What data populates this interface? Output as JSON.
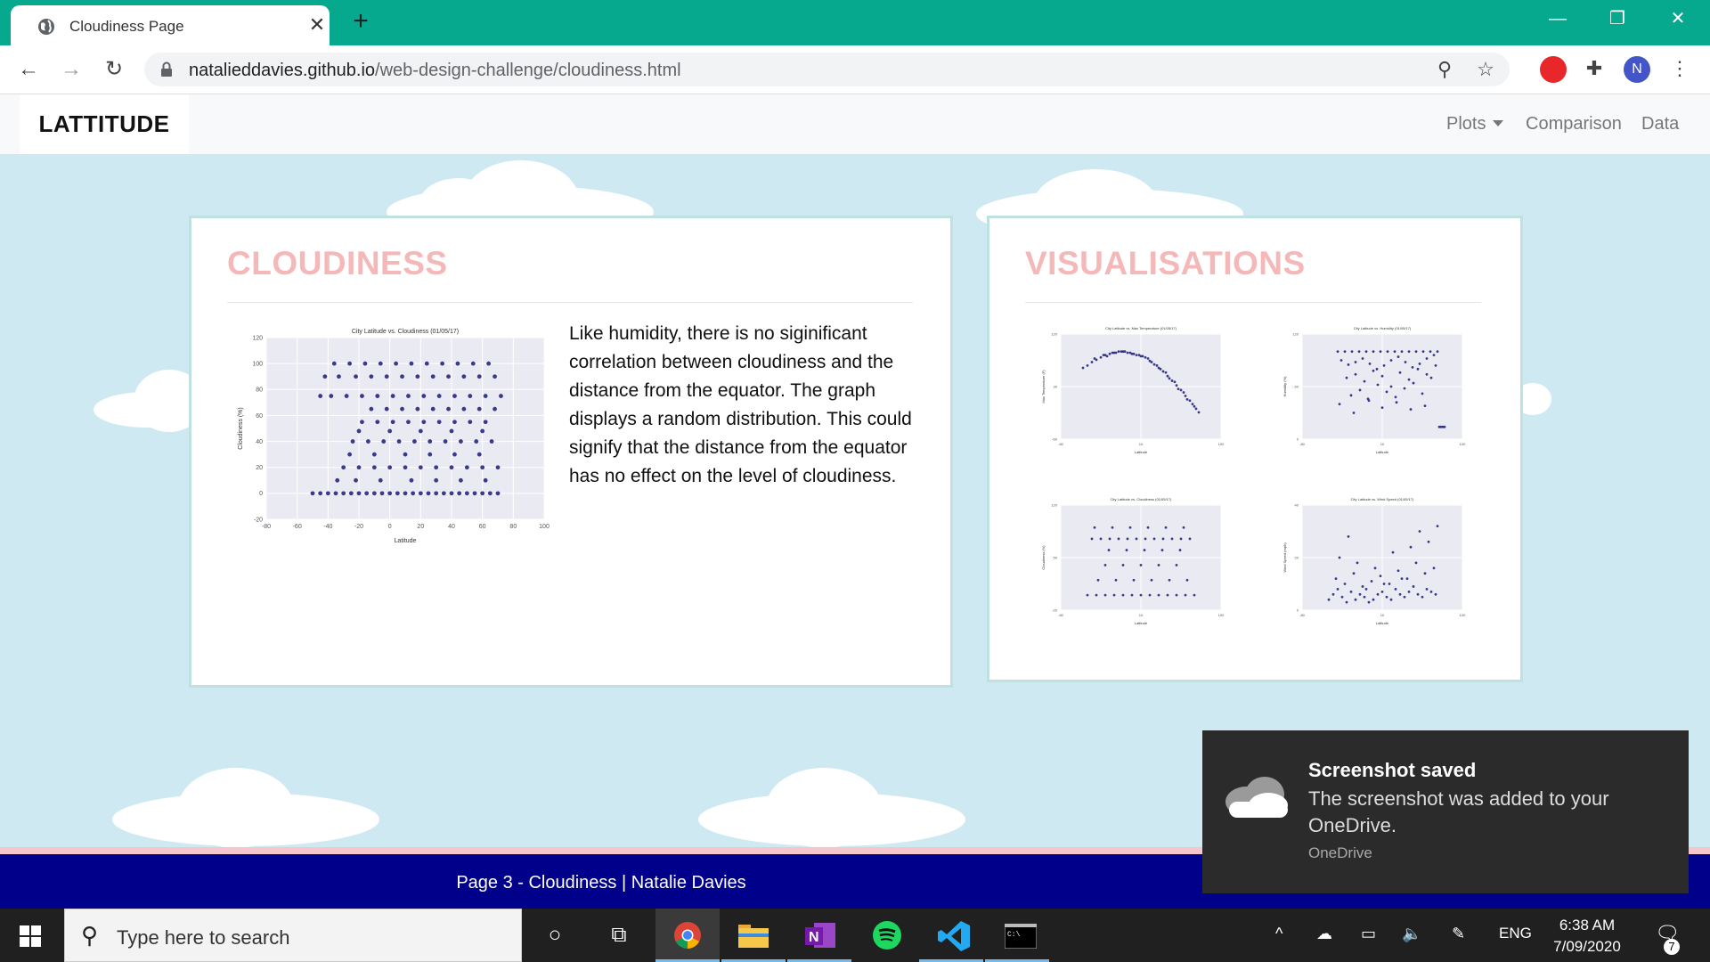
{
  "browser": {
    "tab_title": "Cloudiness Page",
    "url_host": "natalieddavies.github.io",
    "url_path": "/web-design-challenge/cloudiness.html",
    "profile_initial": "N"
  },
  "navbar": {
    "brand": "LATTITUDE",
    "links": [
      "Plots",
      "Comparison",
      "Data"
    ]
  },
  "main": {
    "title": "CLOUDINESS",
    "description": "Like humidity, there is no siginificant correlation between cloudiness and the distance from the equator. The graph displays a random distribution. This could signify that the distance from the equator has no effect on the level of cloudiness."
  },
  "sidebar": {
    "title": "VISUALISATIONS"
  },
  "footer": {
    "text": "Page 3 - Cloudiness | Natalie Davies"
  },
  "toast": {
    "title": "Screenshot saved",
    "body": "The screenshot was added to your OneDrive.",
    "source": "OneDrive"
  },
  "taskbar": {
    "search_placeholder": "Type here to search",
    "language": "ENG",
    "time": "6:38 AM",
    "date": "7/09/2020",
    "notification_count": "7"
  },
  "chart_data": [
    {
      "type": "scatter",
      "title": "City Latitude vs. Cloudiness (01/05/17)",
      "xlabel": "Latitude",
      "ylabel": "Cloudiness (%)",
      "xlim": [
        -80,
        100
      ],
      "ylim": [
        -20,
        120
      ],
      "xticks": [
        -80,
        -60,
        -40,
        -20,
        0,
        20,
        40,
        60,
        80,
        100
      ],
      "yticks": [
        -20,
        0,
        20,
        40,
        60,
        80,
        100,
        120
      ],
      "color": "#1a1a7a",
      "x": [
        -50,
        -45,
        -40,
        -35,
        -30,
        -25,
        -20,
        -15,
        -10,
        -5,
        0,
        5,
        10,
        15,
        20,
        25,
        30,
        35,
        40,
        45,
        50,
        55,
        60,
        65,
        70,
        -45,
        -38,
        -28,
        -18,
        -8,
        2,
        12,
        22,
        32,
        42,
        52,
        62,
        72,
        -42,
        -33,
        -22,
        -12,
        -2,
        8,
        18,
        28,
        38,
        48,
        58,
        68,
        -36,
        -26,
        -16,
        -6,
        4,
        14,
        24,
        34,
        44,
        54,
        64,
        -30,
        -20,
        -10,
        0,
        10,
        20,
        30,
        40,
        50,
        60,
        70,
        -24,
        -14,
        -4,
        6,
        16,
        26,
        36,
        46,
        56,
        66,
        -18,
        -8,
        2,
        12,
        22,
        32,
        42,
        52,
        62,
        -12,
        -2,
        8,
        18,
        28,
        38,
        48,
        58,
        68,
        -34,
        -22,
        -6,
        14,
        30,
        46,
        62,
        -26,
        -10,
        10,
        26,
        42,
        58,
        -20,
        0,
        20,
        40,
        60
      ],
      "y": [
        0,
        0,
        0,
        0,
        0,
        0,
        0,
        0,
        0,
        0,
        0,
        0,
        0,
        0,
        0,
        0,
        0,
        0,
        0,
        0,
        0,
        0,
        0,
        0,
        0,
        75,
        75,
        75,
        75,
        75,
        75,
        75,
        75,
        75,
        75,
        75,
        75,
        75,
        90,
        90,
        90,
        90,
        90,
        90,
        90,
        90,
        90,
        90,
        90,
        90,
        100,
        100,
        100,
        100,
        100,
        100,
        100,
        100,
        100,
        100,
        100,
        20,
        20,
        20,
        20,
        20,
        20,
        20,
        20,
        20,
        20,
        20,
        40,
        40,
        40,
        40,
        40,
        40,
        40,
        40,
        40,
        40,
        55,
        55,
        55,
        55,
        55,
        55,
        55,
        55,
        55,
        65,
        65,
        65,
        65,
        65,
        65,
        65,
        65,
        65,
        10,
        10,
        10,
        10,
        10,
        10,
        10,
        30,
        30,
        30,
        30,
        30,
        30,
        48,
        48,
        48,
        48,
        48
      ]
    },
    {
      "type": "scatter",
      "title": "City Latitude vs. Max Temperature (01/05/17)",
      "xlabel": "Latitude",
      "ylabel": "Max Temperature (F)",
      "xlim": [
        -80,
        100
      ],
      "ylim": [
        -60,
        120
      ],
      "color": "#1a1a7a",
      "x": [
        -55,
        -50,
        -45,
        -40,
        -35,
        -30,
        -25,
        -20,
        -15,
        -10,
        -5,
        0,
        5,
        10,
        15,
        20,
        25,
        30,
        35,
        40,
        45,
        50,
        55,
        60,
        65,
        70,
        75,
        -42,
        -32,
        -22,
        -12,
        -2,
        8,
        18,
        28,
        38,
        48,
        58,
        68,
        -28,
        -18,
        -8,
        2,
        12,
        22,
        32,
        42,
        52,
        62,
        72
      ],
      "y": [
        62,
        66,
        72,
        76,
        80,
        84,
        86,
        88,
        90,
        90,
        88,
        86,
        84,
        82,
        80,
        74,
        68,
        62,
        56,
        48,
        40,
        32,
        24,
        14,
        6,
        -4,
        -14,
        78,
        84,
        88,
        90,
        88,
        84,
        78,
        66,
        54,
        38,
        20,
        0,
        82,
        88,
        90,
        86,
        82,
        72,
        60,
        44,
        26,
        8,
        -8
      ]
    },
    {
      "type": "scatter",
      "title": "City Latitude vs. Humidity (01/05/17)",
      "xlabel": "Latitude",
      "ylabel": "Humidity (%)",
      "xlim": [
        -80,
        100
      ],
      "ylim": [
        0,
        120
      ],
      "color": "#1a1a7a",
      "x": [
        -40,
        -32,
        -24,
        -16,
        -8,
        0,
        8,
        16,
        24,
        32,
        40,
        48,
        56,
        64,
        72,
        -36,
        -28,
        -20,
        -12,
        -4,
        4,
        12,
        20,
        28,
        36,
        44,
        52,
        60,
        68,
        -30,
        -20,
        -10,
        0,
        10,
        20,
        30,
        40,
        50,
        60,
        70,
        -25,
        -15,
        -5,
        5,
        15,
        25,
        35,
        45,
        55,
        65,
        -38,
        -22,
        -6,
        10,
        26,
        42,
        58,
        74,
        76,
        78,
        80
      ],
      "y": [
        100,
        100,
        100,
        100,
        100,
        100,
        100,
        100,
        100,
        100,
        100,
        100,
        100,
        100,
        100,
        90,
        85,
        88,
        92,
        86,
        80,
        84,
        90,
        94,
        88,
        82,
        86,
        92,
        96,
        70,
        74,
        66,
        78,
        72,
        60,
        76,
        68,
        80,
        74,
        84,
        50,
        56,
        44,
        62,
        54,
        48,
        58,
        64,
        52,
        70,
        40,
        30,
        46,
        36,
        42,
        34,
        38,
        14,
        14,
        14,
        14
      ]
    },
    {
      "type": "scatter",
      "title": "City Latitude vs. Cloudiness (01/05/17)",
      "xlabel": "Latitude",
      "ylabel": "Cloudiness (%)",
      "xlim": [
        -80,
        100
      ],
      "ylim": [
        -20,
        120
      ],
      "color": "#1a1a7a",
      "x": [
        -50,
        -40,
        -30,
        -20,
        -10,
        0,
        10,
        20,
        30,
        40,
        50,
        60,
        70,
        -45,
        -35,
        -25,
        -15,
        -5,
        5,
        15,
        25,
        35,
        45,
        55,
        65,
        -42,
        -22,
        -2,
        18,
        38,
        58,
        -38,
        -18,
        2,
        22,
        42,
        62,
        -30,
        -10,
        10,
        30,
        50,
        -26,
        -6,
        14,
        34,
        54
      ],
      "y": [
        0,
        0,
        0,
        0,
        0,
        0,
        0,
        0,
        0,
        0,
        0,
        0,
        0,
        75,
        75,
        75,
        75,
        75,
        75,
        75,
        75,
        75,
        75,
        75,
        75,
        90,
        90,
        90,
        90,
        90,
        90,
        20,
        20,
        20,
        20,
        20,
        20,
        40,
        40,
        40,
        40,
        40,
        60,
        60,
        60,
        60,
        60
      ]
    },
    {
      "type": "scatter",
      "title": "City Latitude vs. Wind Speed (01/05/17)",
      "xlabel": "Latitude",
      "ylabel": "Wind Speed (mph)",
      "xlim": [
        -80,
        100
      ],
      "ylim": [
        0,
        40
      ],
      "color": "#1a1a7a",
      "x": [
        -50,
        -45,
        -40,
        -35,
        -30,
        -25,
        -20,
        -15,
        -10,
        -5,
        0,
        5,
        10,
        15,
        20,
        25,
        30,
        35,
        40,
        45,
        50,
        55,
        60,
        65,
        70,
        -42,
        -32,
        -22,
        -12,
        -2,
        8,
        18,
        28,
        38,
        48,
        58,
        68,
        -38,
        -18,
        2,
        22,
        42,
        62,
        -28,
        -8,
        12,
        32,
        52,
        72
      ],
      "y": [
        4,
        6,
        8,
        5,
        3,
        7,
        4,
        6,
        5,
        3,
        4,
        6,
        7,
        5,
        4,
        8,
        6,
        5,
        7,
        9,
        6,
        5,
        8,
        7,
        6,
        12,
        10,
        14,
        9,
        11,
        13,
        10,
        15,
        12,
        18,
        14,
        16,
        20,
        18,
        16,
        22,
        24,
        26,
        28,
        8,
        10,
        12,
        30,
        32
      ]
    }
  ]
}
